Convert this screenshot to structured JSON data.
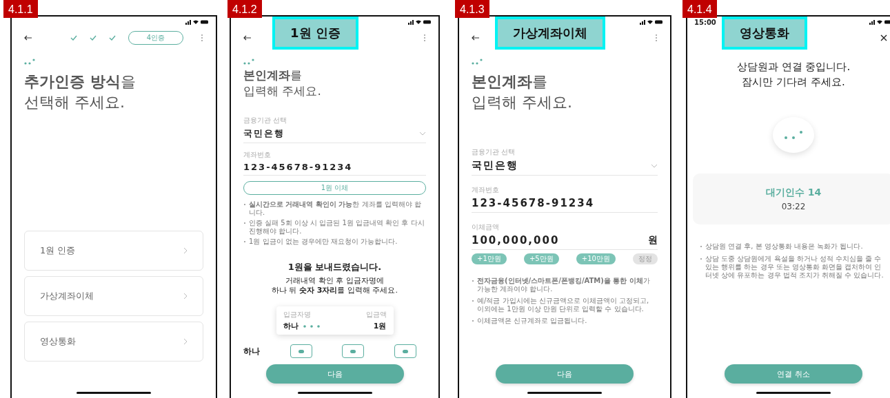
{
  "screens": [
    {
      "tag": "4.1.1",
      "kind": "method-select",
      "steps": [
        {
          "done": true
        },
        {
          "done": true
        },
        {
          "done": true
        },
        {
          "label": "4인증",
          "done": false
        }
      ],
      "title": "**추가인증 방식**을\n선택해 주세요.",
      "options": [
        {
          "label": "1원 인증"
        },
        {
          "label": "가상계좌이체"
        },
        {
          "label": "영상통화"
        }
      ]
    },
    {
      "tag": "4.1.2",
      "kind": "one-won",
      "overlay_label": "1원 인증",
      "title": "**본인계좌**를\n입력해 주세요.",
      "fields": [
        {
          "label": "금융기관 선택",
          "value": "국민은행",
          "dropdown": true
        },
        {
          "label": "계좌번호",
          "value": "123-45678-91234",
          "dropdown": false
        }
      ],
      "transfer_button": "1원 이체",
      "notes": [
        "**실시간으로 거래내역 확인이 가능**한 계좌를 입력해야 합니다.",
        "인증 실패 5회 이상 시 입금된 1원 입금내역 확인 후 다시 진행해야 합니다.",
        "1원 입금이 없는 경우에만 재요청이 가능합니다."
      ],
      "sent_heading": "1원을 보내드렸습니다.",
      "sent_body": "거래내역 확인 후 입금자명에\n하나 뒤 **숫자 3자리**를 입력해 주세요.",
      "example": {
        "sender_label": "입금자명",
        "amount_label": "입금액",
        "sender": "하나",
        "amount": "1원"
      },
      "code_prefix": "하나",
      "code_boxes": [
        {
          "filled": true
        },
        {
          "filled": true
        },
        {
          "filled": true
        }
      ],
      "next_button": "다음"
    },
    {
      "tag": "4.1.3",
      "kind": "virtual-account",
      "overlay_label": "가상계좌이체",
      "title": "**본인계좌**를\n입력해 주세요.",
      "fields": [
        {
          "label": "금융기관 선택",
          "value": "국민은행",
          "dropdown": true
        },
        {
          "label": "계좌번호",
          "value": "123-45678-91234",
          "dropdown": false
        },
        {
          "label": "이체금액",
          "value": "100,000,000",
          "unit": "원",
          "dropdown": false
        }
      ],
      "chips": [
        {
          "label": "+1만원",
          "kind": "add"
        },
        {
          "label": "+5만원",
          "kind": "add"
        },
        {
          "label": "+10만원",
          "kind": "add"
        },
        {
          "label": "정정",
          "kind": "reset"
        }
      ],
      "notes": [
        "**전자금융(인터넷/스마트폰/폰뱅킹/ATM)을 통한 이체**가 가능한 계좌여야 합니다.",
        "예/적금 가입시에는 신규금액으로 이체금액이 고정되고, 이외에는 1만원 이상 만원 단위로 입력할 수 있습니다.",
        "이체금액은 신규계좌로 입금됩니다."
      ],
      "next_button": "다음"
    },
    {
      "tag": "4.1.4",
      "kind": "video-call",
      "overlay_label": "영상통화",
      "status_time": "15:00",
      "message": "상담원과 연결 중입니다.\n잠시만 기다려 주세요.",
      "queue_label": "대기인수 14",
      "queue_time": "03:22",
      "notes": [
        "상담원 연결 후, 본 영상통화 내용은 녹화가 됩니다.",
        "상담 도중 상담원에게 욕설을 하거나 성적 수치심을 줄 수 있는 행위를 하는 경우 또는 영상통화 화면을 캡처하여 인터넷 상에 유포하는 경우 법적 조치가 취해질 수 있습니다."
      ],
      "cancel_button": "연결 취소"
    }
  ]
}
